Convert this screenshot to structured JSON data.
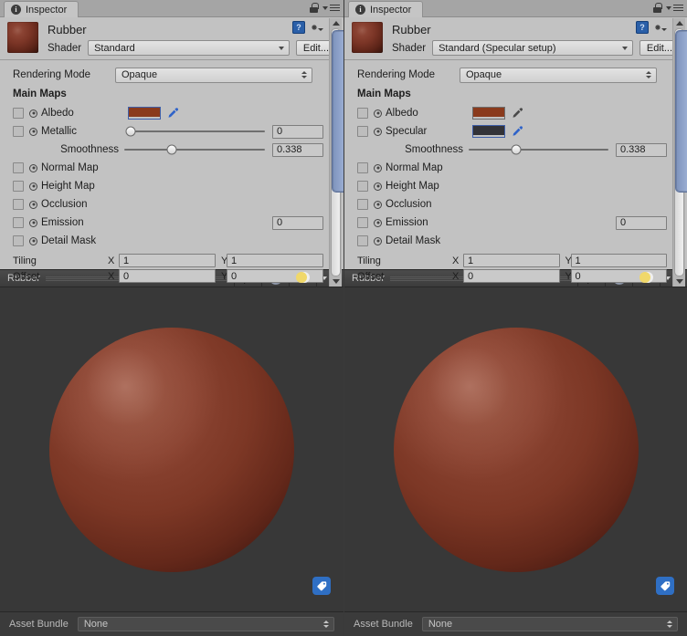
{
  "theme": {
    "panel_bg": "#c2c2c2",
    "preview_bg": "#383838",
    "footer_bg": "#3b3b3b",
    "accent_blue": "#3f5fa8",
    "tag_blue": "#2f6fc4",
    "albedo_color": "#8a3a1c",
    "specular_color": "#333338",
    "scroll_thumb": "#8097c4"
  },
  "panels": [
    {
      "tab": {
        "label": "Inspector",
        "icon": "info-icon"
      },
      "header": {
        "lock_icon": "lock-icon",
        "menu_icon": "hamburger-menu-icon",
        "help_icon": "help-book-icon",
        "gear_icon": "gear-icon"
      },
      "material": {
        "name": "Rubber",
        "thumbnail": "material-sphere-thumbnail",
        "shader_label": "Shader",
        "shader_value": "Standard",
        "edit_label": "Edit..."
      },
      "rendering_mode": {
        "label": "Rendering Mode",
        "value": "Opaque"
      },
      "section_title": "Main Maps",
      "rows": [
        {
          "kind": "color",
          "label": "Albedo",
          "checkbox": true,
          "color": "#8a3a1c",
          "focused": true,
          "picker": true
        },
        {
          "kind": "slider",
          "label": "Metallic",
          "checkbox": true,
          "value": "0",
          "fraction": 0.0
        },
        {
          "kind": "slider",
          "label": "Smoothness",
          "checkbox": false,
          "value": "0.338",
          "fraction": 0.338,
          "indent": true
        },
        {
          "kind": "plain",
          "label": "Normal Map",
          "checkbox": true
        },
        {
          "kind": "plain",
          "label": "Height Map",
          "checkbox": true
        },
        {
          "kind": "plain",
          "label": "Occlusion",
          "checkbox": true
        },
        {
          "kind": "number",
          "label": "Emission",
          "checkbox": true,
          "value": "0"
        },
        {
          "kind": "plain",
          "label": "Detail Mask",
          "checkbox": true
        }
      ],
      "tiling": {
        "label": "Tiling",
        "x_label": "X",
        "x": "1",
        "y_label": "Y",
        "y": "1"
      },
      "offset": {
        "label": "Offset",
        "x_label": "X",
        "x": "0",
        "y_label": "Y",
        "y": "0"
      },
      "preview": {
        "title": "Rubber",
        "play_icon": "play-icon",
        "shape_icon": "sphere-preview-icon",
        "lighting_icon": "lighting-toggle-icon",
        "menu_icon": "preview-menu-icon",
        "tag_icon": "asset-label-tag-icon"
      },
      "footer": {
        "label": "Asset Bundle",
        "value": "None"
      }
    },
    {
      "tab": {
        "label": "Inspector",
        "icon": "info-icon"
      },
      "header": {
        "lock_icon": "lock-icon",
        "menu_icon": "hamburger-menu-icon",
        "help_icon": "help-book-icon",
        "gear_icon": "gear-icon"
      },
      "material": {
        "name": "Rubber",
        "thumbnail": "material-sphere-thumbnail",
        "shader_label": "Shader",
        "shader_value": "Standard (Specular setup)",
        "edit_label": "Edit..."
      },
      "rendering_mode": {
        "label": "Rendering Mode",
        "value": "Opaque"
      },
      "section_title": "Main Maps",
      "rows": [
        {
          "kind": "color",
          "label": "Albedo",
          "checkbox": true,
          "color": "#8a3a1c",
          "focused": false,
          "picker": true
        },
        {
          "kind": "color",
          "label": "Specular",
          "checkbox": true,
          "color": "#333338",
          "focused": true,
          "picker": true
        },
        {
          "kind": "slider",
          "label": "Smoothness",
          "checkbox": false,
          "value": "0.338",
          "fraction": 0.338,
          "indent": true
        },
        {
          "kind": "plain",
          "label": "Normal Map",
          "checkbox": true
        },
        {
          "kind": "plain",
          "label": "Height Map",
          "checkbox": true
        },
        {
          "kind": "plain",
          "label": "Occlusion",
          "checkbox": true
        },
        {
          "kind": "number",
          "label": "Emission",
          "checkbox": true,
          "value": "0"
        },
        {
          "kind": "plain",
          "label": "Detail Mask",
          "checkbox": true
        }
      ],
      "tiling": {
        "label": "Tiling",
        "x_label": "X",
        "x": "1",
        "y_label": "Y",
        "y": "1"
      },
      "offset": {
        "label": "Offset",
        "x_label": "X",
        "x": "0",
        "y_label": "Y",
        "y": "0"
      },
      "preview": {
        "title": "Rubber",
        "play_icon": "play-icon",
        "shape_icon": "sphere-preview-icon",
        "lighting_icon": "lighting-toggle-icon",
        "menu_icon": "preview-menu-icon",
        "tag_icon": "asset-label-tag-icon"
      },
      "footer": {
        "label": "Asset Bundle",
        "value": "None"
      }
    }
  ]
}
